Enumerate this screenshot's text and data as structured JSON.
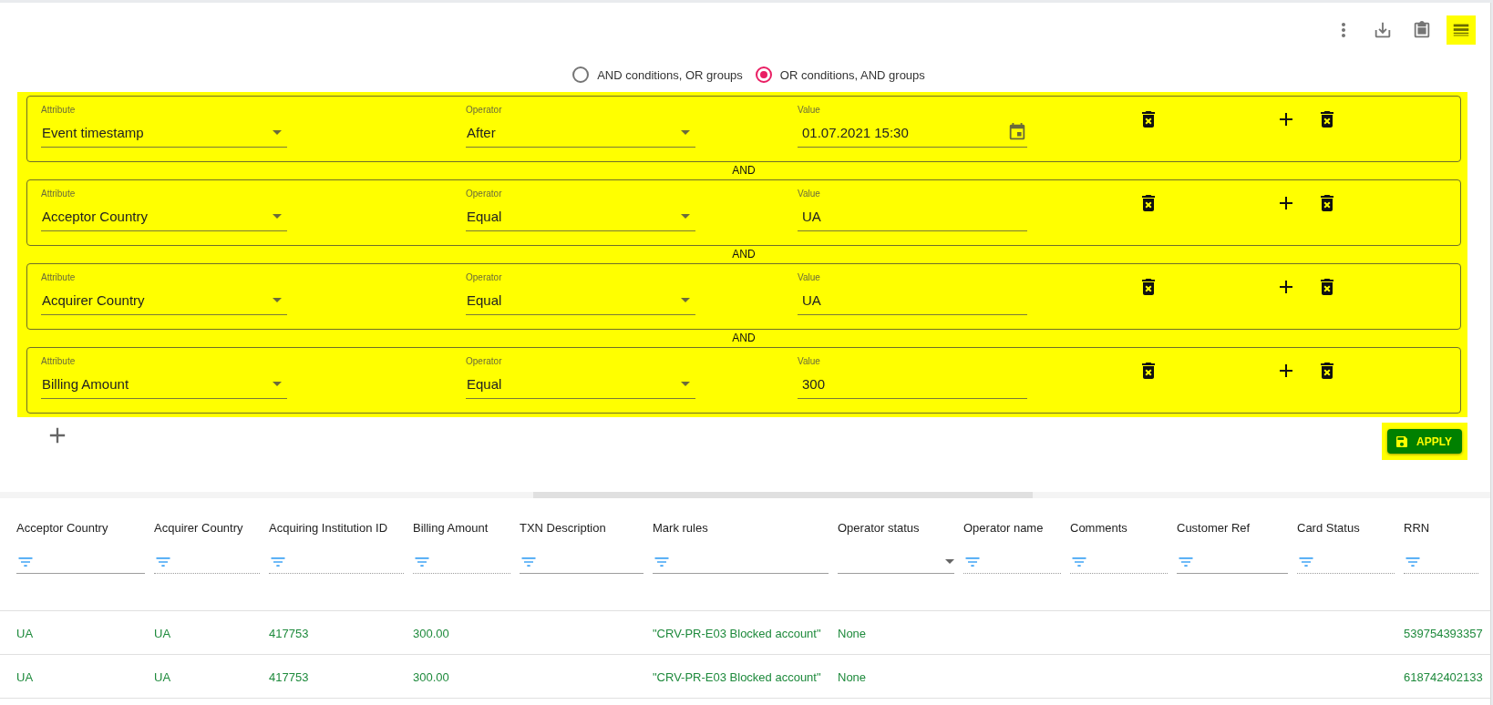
{
  "toolbar": {
    "buttons": [
      {
        "kind": "more",
        "highlighted": false
      },
      {
        "kind": "download",
        "highlighted": false
      },
      {
        "kind": "clipboard",
        "highlighted": false
      },
      {
        "kind": "list",
        "highlighted": true
      }
    ]
  },
  "logic": [
    {
      "label": "AND conditions, OR groups",
      "selected": false
    },
    {
      "label": "OR conditions, AND groups",
      "selected": true
    }
  ],
  "panel": {
    "highlighted": true,
    "groups": [
      {
        "attribute": {
          "label": "Attribute",
          "value": "Event timestamp"
        },
        "operator": {
          "label": "Operator",
          "value": "After"
        },
        "value": {
          "label": "Value",
          "value": "01.07.2021 15:30",
          "kind": "date"
        }
      },
      {
        "join": "AND",
        "attribute": {
          "label": "Attribute",
          "value": "Acceptor Country"
        },
        "operator": {
          "label": "Operator",
          "value": "Equal"
        },
        "value": {
          "label": "Value",
          "value": "UA",
          "kind": "text"
        }
      },
      {
        "join": "AND",
        "attribute": {
          "label": "Attribute",
          "value": "Acquirer Country"
        },
        "operator": {
          "label": "Operator",
          "value": "Equal"
        },
        "value": {
          "label": "Value",
          "value": "UA",
          "kind": "text"
        }
      },
      {
        "join": "AND",
        "attribute": {
          "label": "Attribute",
          "value": "Billing Amount"
        },
        "operator": {
          "label": "Operator",
          "value": "Equal"
        },
        "value": {
          "label": "Value",
          "value": "300",
          "kind": "text"
        }
      }
    ]
  },
  "apply": {
    "label": "APPLY",
    "highlighted": true
  },
  "table": {
    "columns": [
      {
        "label": "Acceptor Country",
        "kind": "solid"
      },
      {
        "label": "Acquirer Country",
        "kind": "dotted"
      },
      {
        "label": "Acquiring Institution ID",
        "kind": "dotted"
      },
      {
        "label": "Billing Amount",
        "kind": "dotted"
      },
      {
        "label": "TXN Description",
        "kind": "solid"
      },
      {
        "label": "Mark rules",
        "kind": "solid"
      },
      {
        "label": "Operator status",
        "kind": "select"
      },
      {
        "label": "Operator name",
        "kind": "dotted"
      },
      {
        "label": "Comments",
        "kind": "dotted"
      },
      {
        "label": "Customer Ref",
        "kind": "solid"
      },
      {
        "label": "Card Status",
        "kind": "dotted"
      },
      {
        "label": "RRN",
        "kind": "dotted"
      }
    ],
    "rows": [
      [
        "UA",
        "UA",
        "417753",
        "300.00",
        null,
        "\"CRV-PR-E03 Blocked account\"",
        "None",
        null,
        null,
        null,
        null,
        "539754393357"
      ],
      [
        "UA",
        "UA",
        "417753",
        "300.00",
        null,
        "\"CRV-PR-E03 Blocked account\"",
        "None",
        null,
        null,
        null,
        null,
        "618742402133"
      ]
    ]
  }
}
